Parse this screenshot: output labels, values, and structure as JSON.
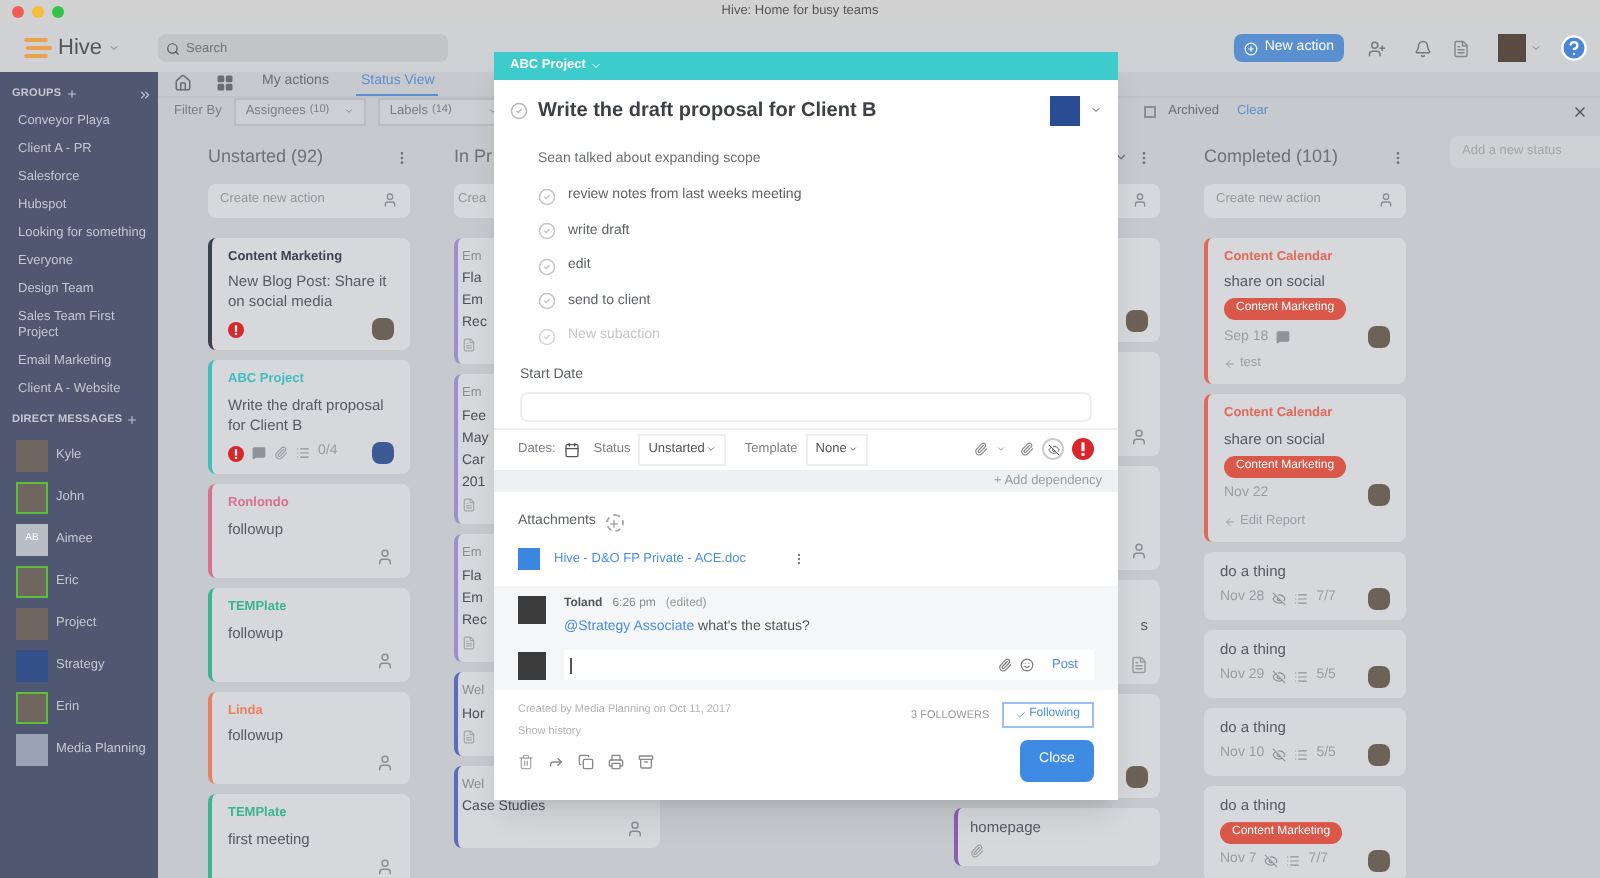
{
  "window": {
    "title": "Hive: Home for busy teams"
  },
  "topbar": {
    "logo": "Hive",
    "search_placeholder": "Search",
    "new_action": "New action"
  },
  "sidebar": {
    "groups_heading": "GROUPS",
    "groups": [
      "Conveyor Playa",
      "Client A - PR",
      "Salesforce",
      "Hubspot",
      "Looking for something",
      "Everyone",
      "Design Team",
      "Sales Team First Project",
      "Email Marketing",
      "Client A - Website"
    ],
    "dm_heading": "DIRECT MESSAGES",
    "people": [
      {
        "name": "Kyle",
        "kind": "photo",
        "online": false
      },
      {
        "name": "John",
        "kind": "photo",
        "online": true
      },
      {
        "name": "Aimee",
        "kind": "initials",
        "initials": "AB",
        "online": false
      },
      {
        "name": "Eric",
        "kind": "photo",
        "online": true
      },
      {
        "name": "Project",
        "kind": "photo",
        "online": false
      },
      {
        "name": "Strategy",
        "kind": "blue",
        "online": false
      },
      {
        "name": "Erin",
        "kind": "photo",
        "online": true
      },
      {
        "name": "Media Planning",
        "kind": "blank",
        "online": false
      }
    ]
  },
  "nav": {
    "tabs": [
      {
        "label": "My actions",
        "selected": false
      },
      {
        "label": "Status View",
        "selected": true
      }
    ]
  },
  "filter": {
    "label": "Filter By",
    "dropdowns": [
      {
        "label": "Assignees",
        "count": "(10)"
      },
      {
        "label": "Labels",
        "count": "(14)"
      }
    ],
    "archived": {
      "label": "Archived",
      "checked": false
    },
    "clear": "Clear"
  },
  "columns": [
    {
      "kind": "full",
      "title": "Unstarted (92)",
      "create_placeholder": "Create new action",
      "cards": [
        {
          "project": "Content Marketing",
          "color": "#3a4350",
          "title": "New Blog Post: Share it on social media",
          "urgent": true,
          "avatar": {
            "kind": "photo"
          }
        },
        {
          "project": "ABC Project",
          "color": "#3fbfbf",
          "title": "Write the draft proposal for Client B",
          "urgent": true,
          "comment": true,
          "attachment": true,
          "checklist": "0/4",
          "avatar": {
            "kind": "blue"
          }
        },
        {
          "project": "Ronlondo",
          "color": "#d9708f",
          "title": "followup",
          "avatar": {
            "kind": "person"
          }
        },
        {
          "project": "TEMPlate",
          "color": "#3ab58f",
          "title": "followup",
          "avatar": {
            "kind": "person"
          }
        },
        {
          "project": "Linda",
          "color": "#e8805f",
          "title": "followup",
          "avatar": {
            "kind": "person"
          }
        },
        {
          "project": "TEMPlate",
          "color": "#3ab58f",
          "title": "first meeting",
          "avatar": {
            "kind": "person"
          }
        }
      ]
    },
    {
      "kind": "covered",
      "title": "In Pr",
      "create_placeholder": "Crea",
      "cards": [
        {
          "label": "Em",
          "color": "#9b8fcf",
          "lines": [
            "Fla",
            "Em",
            "Rec"
          ]
        },
        {
          "label": "Em",
          "color": "#9b8fcf",
          "lines": [
            "Fee",
            "May",
            "Car",
            "201"
          ]
        },
        {
          "label": "Em",
          "color": "#9b8fcf",
          "lines": [
            "Fla",
            "Em",
            "Rec"
          ]
        },
        {
          "label": "Wel",
          "color": "#5a6cc0",
          "lines": [
            "Hor"
          ]
        },
        {
          "label": "Wel",
          "color": "#5a6cc0",
          "lines": [
            "Case Studies"
          ],
          "avatar": {
            "kind": "person"
          }
        }
      ]
    },
    {
      "kind": "tail",
      "cards": [
        {
          "avatar": {
            "kind": "photo"
          }
        },
        {
          "avatar": {
            "kind": "person"
          }
        },
        {
          "avatar": {
            "kind": "person"
          }
        },
        {
          "fragment": "s",
          "avatar": {
            "kind": "doc"
          }
        },
        {
          "avatar": {
            "kind": "photo"
          }
        },
        {
          "color": "#8e5bb8",
          "lines": [
            "homepage"
          ]
        }
      ]
    },
    {
      "kind": "full",
      "title": "Completed (101)",
      "create_placeholder": "Create new action",
      "cards": [
        {
          "project": "Content Calendar",
          "color": "#e2685a",
          "title": "share on social",
          "tag": "Content Marketing",
          "date": "Sep 18",
          "comment": true,
          "link": "test",
          "avatar": {
            "kind": "photo"
          }
        },
        {
          "project": "Content Calendar",
          "color": "#e2685a",
          "title": "share on social",
          "tag": "Content Marketing",
          "date": "Nov 22",
          "link": "Edit Report",
          "avatar": {
            "kind": "photo"
          }
        },
        {
          "title": "do a thing",
          "date": "Nov 28",
          "private": true,
          "checklist": "7/7",
          "avatar": {
            "kind": "photo"
          }
        },
        {
          "title": "do a thing",
          "date": "Nov 29",
          "private": true,
          "checklist": "5/5",
          "avatar": {
            "kind": "photo"
          }
        },
        {
          "title": "do a thing",
          "date": "Nov 10",
          "private": true,
          "checklist": "5/5",
          "avatar": {
            "kind": "photo"
          }
        },
        {
          "title": "do a thing",
          "tag": "Content Marketing",
          "date": "Nov 7",
          "private": true,
          "checklist": "7/7",
          "avatar": {
            "kind": "photo"
          }
        }
      ]
    }
  ],
  "add_status_placeholder": "Add a new status",
  "modal": {
    "project": "ABC Project",
    "title": "Write the draft proposal for Client B",
    "description": "Sean talked about expanding scope",
    "subactions": [
      "review notes from last weeks meeting",
      "write draft",
      "edit",
      "send to client"
    ],
    "new_subaction_placeholder": "New subaction",
    "start_date_label": "Start Date",
    "dates_label": "Dates:",
    "status_label": "Status",
    "status_value": "Unstarted",
    "template_label": "Template",
    "template_value": "None",
    "urgent": true,
    "add_dependency": "+ Add dependency",
    "attachments_label": "Attachments",
    "attachments": [
      "Hive - D&O FP Private - ACE.doc"
    ],
    "comment": {
      "author": "Toland",
      "time": "6:26 pm",
      "edited": "(edited)",
      "mention": "@Strategy Associate",
      "text": "what's the status?"
    },
    "post": "Post",
    "created": "Created by Media Planning on Oct 11, 2017",
    "show_history": "Show history",
    "followers": "3 FOLLOWERS",
    "following": "Following",
    "close": "Close"
  }
}
